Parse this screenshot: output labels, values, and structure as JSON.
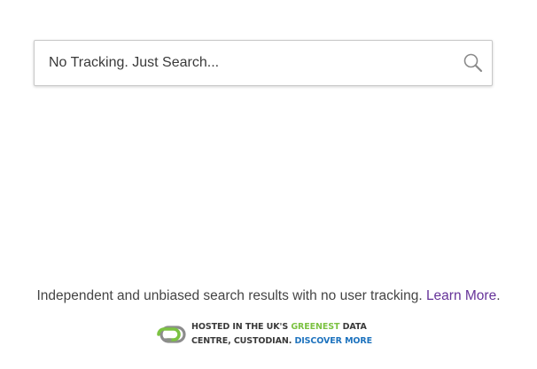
{
  "search": {
    "placeholder": "No Tracking. Just Search...",
    "button_icon": "search-icon"
  },
  "footer": {
    "tagline_text": "Independent and unbiased search results with no user tracking.",
    "learn_more_label": "Learn More",
    "learn_more_color": "#663399"
  },
  "hosting_badge": {
    "logo_icon": "custodian-logo-icon",
    "line1_prefix": "HOSTED IN THE UK'S",
    "line1_highlight": "GREENEST",
    "line1_suffix": "DATA",
    "line2_text": "CENTRE, CUSTODIAN.",
    "discover_label": "DISCOVER MORE",
    "highlight_color": "#7cc242",
    "link_color": "#1e73be"
  }
}
